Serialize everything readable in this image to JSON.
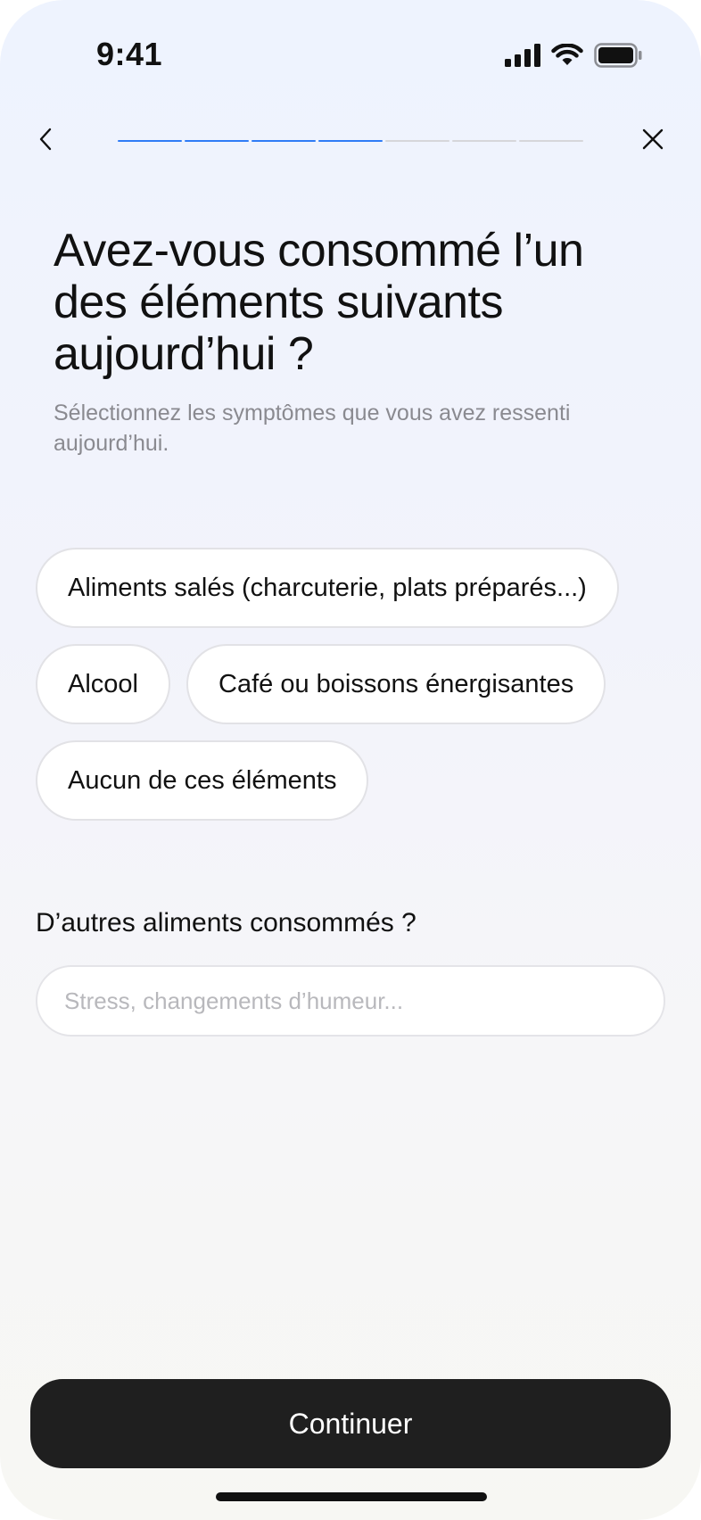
{
  "status_bar": {
    "time": "9:41",
    "icons": [
      "cellular-signal-icon",
      "wifi-icon",
      "battery-icon"
    ]
  },
  "nav": {
    "back_icon": "chevron-left-icon",
    "close_icon": "close-icon",
    "progress": {
      "total_steps": 7,
      "completed_steps": 4,
      "active_color": "#2f7cf6",
      "inactive_color": "#d6d6da"
    }
  },
  "question": {
    "title": "Avez-vous consommé l’un des éléments suivants aujourd’hui ?",
    "subtitle": "Sélectionnez les symptômes que vous avez ressenti aujourd’hui."
  },
  "options": [
    {
      "label": "Aliments salés (charcuterie, plats préparés...)",
      "selected": false
    },
    {
      "label": "Alcool",
      "selected": false
    },
    {
      "label": "Café ou boissons énergisantes",
      "selected": false
    },
    {
      "label": "Aucun de ces éléments",
      "selected": false
    }
  ],
  "other_foods": {
    "label": "D’autres aliments consommés ?",
    "value": "",
    "placeholder": "Stress, changements d’humeur..."
  },
  "footer": {
    "continue_label": "Continuer",
    "button_color": "#1f1f1f"
  }
}
